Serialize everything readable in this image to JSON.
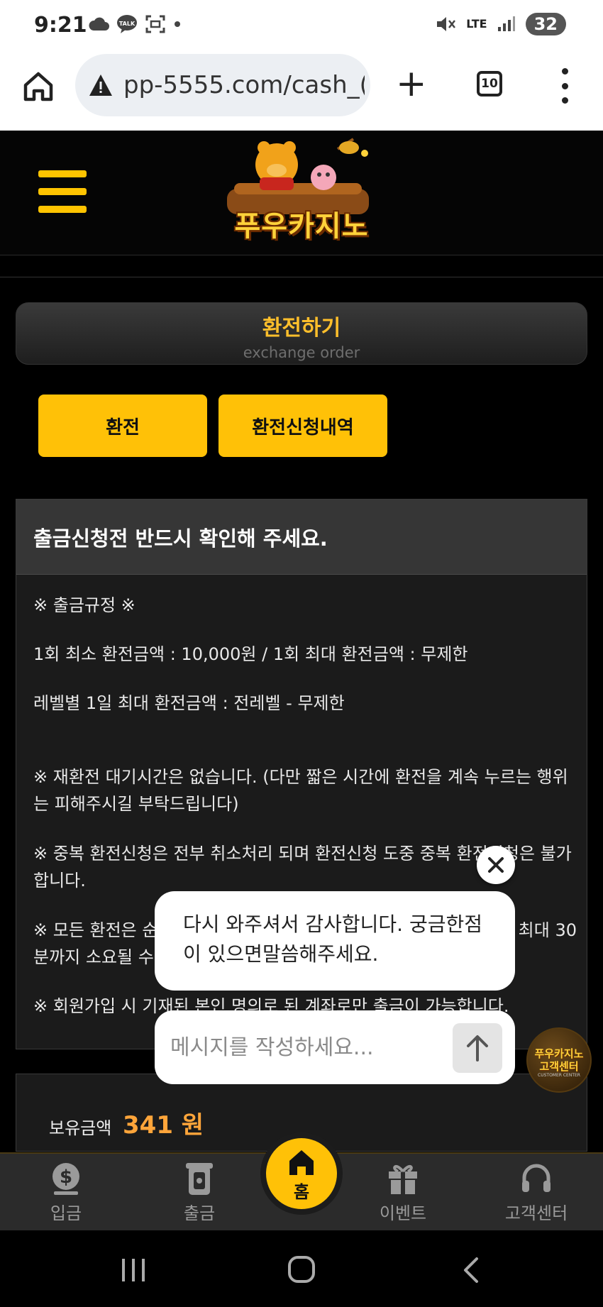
{
  "status_bar": {
    "time": "9:21",
    "battery": "32",
    "network": "LTE"
  },
  "browser": {
    "url": "pp-5555.com/cash_(",
    "tab_count": "10"
  },
  "header": {
    "logo_text": "푸우카지노"
  },
  "page": {
    "title": "환전하기",
    "subtitle": "exchange order"
  },
  "tabs": {
    "exchange": "환전",
    "history": "환전신청내역"
  },
  "notice": {
    "heading": "출금신청전 반드시 확인해 주세요.",
    "rule_title": "※ 출금규정 ※",
    "line1": "1회 최소 환전금액 : 10,000원 / 1회 최대 환전금액 : 무제한",
    "line2": "레벨별 1일 최대 환전금액 : 전레벨 - 무제한",
    "line3": "※ 재환전 대기시간은 없습니다. (다만 짧은 시간에 환전을 계속 누르는 행위는 피해주시길 부탁드립니다)",
    "line4": "※ 중복 환전신청은 전부 취소처리 되며 환전신청 도중 중복 환전신청은 불가합니다.",
    "line5a": "※ 모든 환전은 순",
    "line5b": "최대 30",
    "line5c": "분까지 소요될 수",
    "line6": "※ 회원가입 시 기재된 본인 명의로 된 계좌로만 출금이 가능합니다."
  },
  "balance": {
    "label": "보유금액",
    "value": "341 원"
  },
  "bottom_nav": {
    "deposit": "입금",
    "withdraw": "출금",
    "home": "홈",
    "event": "이벤트",
    "support": "고객센터"
  },
  "chat": {
    "message": "다시 와주셔서 감사합니다. 궁금한점이 있으면말씀해주세요.",
    "placeholder": "메시지를 작성하세요...",
    "badge_text": "푸우카지노 고객센터",
    "badge_sub": "CUSTOMER CENTER"
  },
  "colors": {
    "accent": "#ffc107",
    "title_gold": "#ffbf2b",
    "balance_orange": "#ffa53a"
  }
}
